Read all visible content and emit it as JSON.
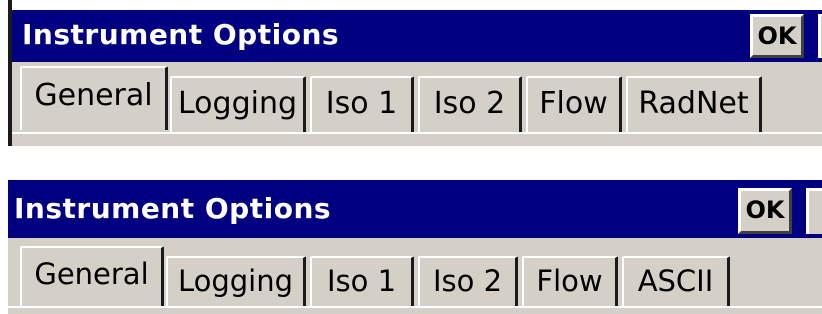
{
  "panels": [
    {
      "title": "Instrument Options",
      "ok_label": "OK",
      "tabs": [
        {
          "label": "General",
          "selected": true
        },
        {
          "label": "Logging",
          "selected": false
        },
        {
          "label": "Iso 1",
          "selected": false
        },
        {
          "label": "Iso 2",
          "selected": false
        },
        {
          "label": "Flow",
          "selected": false
        },
        {
          "label": "RadNet",
          "selected": false
        }
      ]
    },
    {
      "title": "Instrument Options",
      "ok_label": "OK",
      "tabs": [
        {
          "label": "General",
          "selected": true
        },
        {
          "label": "Logging",
          "selected": false
        },
        {
          "label": "Iso 1",
          "selected": false
        },
        {
          "label": "Iso 2",
          "selected": false
        },
        {
          "label": "Flow",
          "selected": false
        },
        {
          "label": "ASCII",
          "selected": false
        }
      ]
    }
  ],
  "colors": {
    "titlebar_bg": "#000080",
    "title_text": "#ffffff",
    "face": "#d4d0c8"
  }
}
